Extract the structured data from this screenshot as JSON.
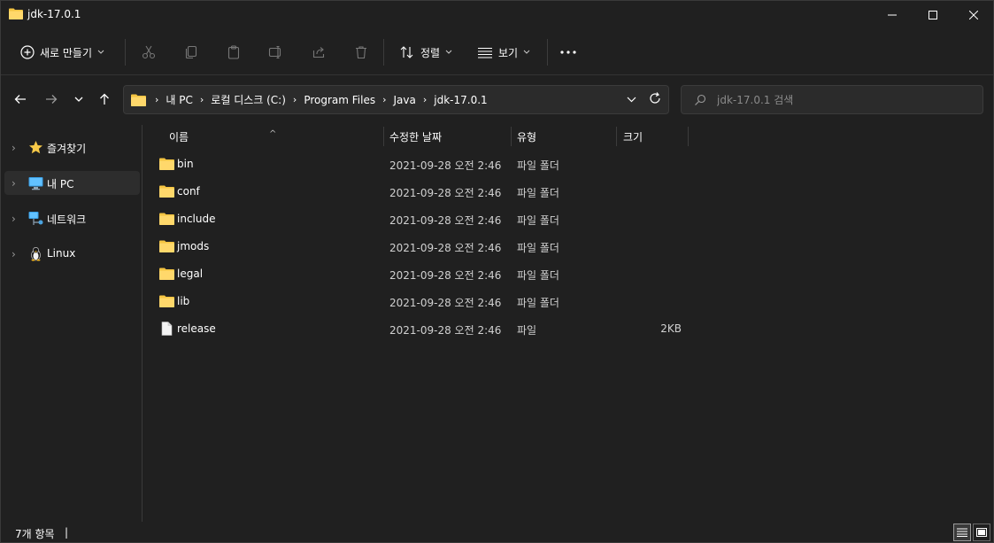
{
  "window": {
    "title": "jdk-17.0.1"
  },
  "command_bar": {
    "new_label": "새로 만들기",
    "sort_label": "정렬",
    "view_label": "보기",
    "icons": [
      "cut-icon",
      "copy-icon",
      "paste-icon",
      "rename-icon",
      "share-icon",
      "delete-icon"
    ]
  },
  "address": {
    "crumbs": [
      "내 PC",
      "로컬 디스크 (C:)",
      "Program Files",
      "Java",
      "jdk-17.0.1"
    ]
  },
  "search": {
    "placeholder": "jdk-17.0.1 검색"
  },
  "sidebar": {
    "items": [
      {
        "label": "즐겨찾기",
        "icon": "star-icon"
      },
      {
        "label": "내 PC",
        "icon": "monitor-icon",
        "selected": true
      },
      {
        "label": "네트워크",
        "icon": "network-icon"
      },
      {
        "label": "Linux",
        "icon": "penguin-icon"
      }
    ]
  },
  "columns": {
    "name": "이름",
    "date": "수정한 날짜",
    "type": "유형",
    "size": "크기"
  },
  "files": [
    {
      "name": "bin",
      "date": "2021-09-28 오전 2:46",
      "type": "파일 폴더",
      "size": "",
      "kind": "folder"
    },
    {
      "name": "conf",
      "date": "2021-09-28 오전 2:46",
      "type": "파일 폴더",
      "size": "",
      "kind": "folder"
    },
    {
      "name": "include",
      "date": "2021-09-28 오전 2:46",
      "type": "파일 폴더",
      "size": "",
      "kind": "folder"
    },
    {
      "name": "jmods",
      "date": "2021-09-28 오전 2:46",
      "type": "파일 폴더",
      "size": "",
      "kind": "folder"
    },
    {
      "name": "legal",
      "date": "2021-09-28 오전 2:46",
      "type": "파일 폴더",
      "size": "",
      "kind": "folder"
    },
    {
      "name": "lib",
      "date": "2021-09-28 오전 2:46",
      "type": "파일 폴더",
      "size": "",
      "kind": "folder"
    },
    {
      "name": "release",
      "date": "2021-09-28 오전 2:46",
      "type": "파일",
      "size": "2KB",
      "kind": "file"
    }
  ],
  "status": {
    "item_count": "7개 항목",
    "caret": "|"
  },
  "colors": {
    "background": "#202020",
    "folder": "#f5c542",
    "accent": "#4cc2ff"
  }
}
